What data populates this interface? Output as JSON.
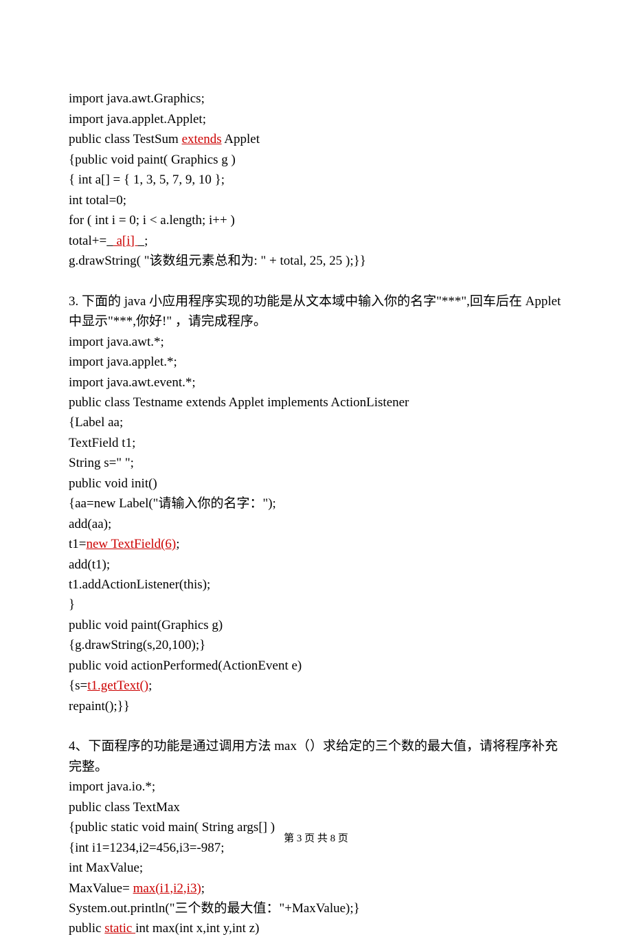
{
  "block1": {
    "l1": "import java.awt.Graphics;",
    "l2": "import java.applet.Applet;",
    "l3a": "public class TestSum ",
    "l3b": "extends",
    "l3c": " Applet",
    "l4": "{public void paint( Graphics g )",
    "l5": "{ int a[] = { 1, 3, 5, 7, 9, 10 };",
    "l6": "int total=0;",
    "l7": "for ( int i = 0; i < a.length; i++ )",
    "l8a": "total+=",
    "l8b": " a[i] ",
    "l8c": ";",
    "l9": "g.drawString( \"该数组元素总和为: \" + total, 25, 25 );}}"
  },
  "q3": {
    "intro": "3. 下面的 java 小应用程序实现的功能是从文本域中输入你的名字\"***\",回车后在 Applet 中显示\"***,你好!\" ，请完成程序。",
    "l1": "import java.awt.*;",
    "l2": "import java.applet.*;",
    "l3": "import java.awt.event.*;",
    "l4": "public class Testname extends Applet implements ActionListener",
    "l5": "{Label aa;",
    "l6": "TextField t1;",
    "l7": "String s=\" \";",
    "l8": "public void init()",
    "l9": "{aa=new Label(\"请输入你的名字：\");",
    "l10": "add(aa);",
    "l11a": "t1=",
    "l11b": "new TextField(6)",
    "l11c": ";",
    "l12": "add(t1);",
    "l13": "t1.addActionListener(this);",
    "l14": "}",
    "l15": "public void paint(Graphics g)",
    "l16": "{g.drawString(s,20,100);}",
    "l17": "public void actionPerformed(ActionEvent e)",
    "l18a": "{s=",
    "l18b": "t1.getText()",
    "l18c": ";",
    "l19": "repaint();}}"
  },
  "q4": {
    "intro": "4、下面程序的功能是通过调用方法 max（）求给定的三个数的最大值，请将程序补充完整。",
    "l1": "import java.io.*;",
    "l2": "public class TextMax",
    "l3": "{public static void main( String args[] )",
    "l4": "{int i1=1234,i2=456,i3=-987;",
    "l5": "int MaxValue;",
    "l6a": "MaxValue= ",
    "l6b": "max(i1,i2,i3)",
    "l6c": ";",
    "l7": "System.out.println(\"三个数的最大值：\"+MaxValue);}",
    "l8a": "public ",
    "l8b": "static ",
    "l8c": "int max(int x,int y,int z)"
  },
  "footer": "第 3 页 共 8 页"
}
